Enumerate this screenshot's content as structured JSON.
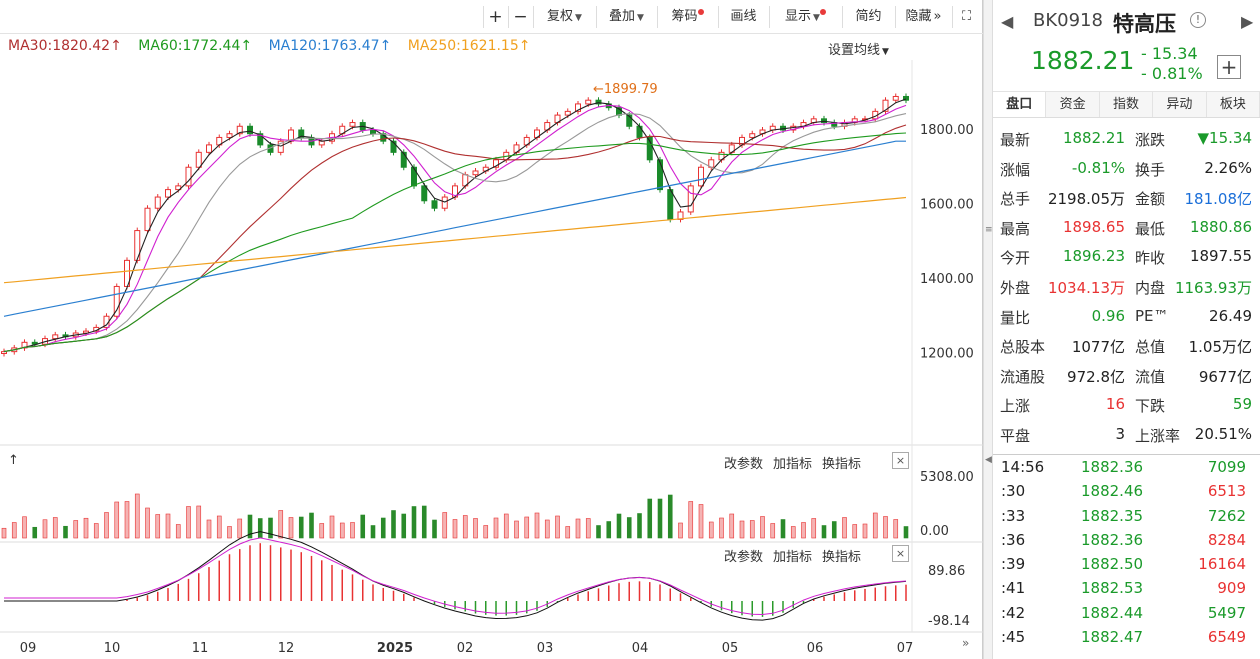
{
  "toolbar": {
    "plus": "+",
    "minus": "−",
    "fuquan": "复权",
    "diejia": "叠加",
    "chouma": "筹码",
    "huaxian": "画线",
    "xianshi": "显示",
    "jianyue": "简约",
    "yincang": "隐藏",
    "forward_icon": "»",
    "fullscreen_icon": "⛶"
  },
  "ma": {
    "ma30": "MA30:1820.42",
    "ma60": "MA60:1772.44",
    "ma120": "MA120:1763.47",
    "ma250": "MA250:1621.15",
    "arrow": "↑",
    "set_label": "设置均线",
    "colors": {
      "ma30": "#b03030",
      "ma60": "#1f9a1f",
      "ma120": "#2a7fd0",
      "ma250": "#f0a020"
    }
  },
  "chart_data": {
    "type": "candlestick",
    "price_axis": [
      "1800.00",
      "1600.00",
      "1400.00",
      "1200.00"
    ],
    "high_annotation": "1899.79",
    "volume_axis": [
      "5308.00",
      "0.00"
    ],
    "macd_axis": [
      "89.86",
      "-98.14"
    ],
    "x_labels": [
      "09",
      "10",
      "11",
      "12",
      "2025",
      "02",
      "03",
      "04",
      "05",
      "06",
      "07"
    ],
    "price_close": [
      1205,
      1215,
      1230,
      1225,
      1240,
      1250,
      1245,
      1255,
      1260,
      1270,
      1300,
      1380,
      1450,
      1530,
      1590,
      1620,
      1640,
      1650,
      1700,
      1740,
      1760,
      1780,
      1790,
      1810,
      1790,
      1760,
      1740,
      1770,
      1800,
      1780,
      1760,
      1770,
      1790,
      1810,
      1820,
      1800,
      1790,
      1770,
      1740,
      1700,
      1650,
      1610,
      1590,
      1620,
      1650,
      1680,
      1690,
      1700,
      1720,
      1740,
      1760,
      1780,
      1800,
      1820,
      1840,
      1850,
      1870,
      1880,
      1870,
      1860,
      1840,
      1810,
      1780,
      1720,
      1640,
      1560,
      1580,
      1650,
      1700,
      1720,
      1740,
      1760,
      1780,
      1790,
      1800,
      1810,
      1800,
      1810,
      1820,
      1830,
      1820,
      1810,
      1820,
      1830,
      1830,
      1850,
      1880,
      1890,
      1880
    ]
  },
  "panels": {
    "gaicanshu": "改参数",
    "jiazhibiao": "加指标",
    "huanzhibiao": "换指标",
    "close": "×"
  },
  "stock": {
    "code": "BK0918",
    "name": "特高压",
    "price": "1882.21",
    "change": "- 15.34",
    "change_pct": "- 0.81%",
    "add_icon": "+"
  },
  "tabs": [
    "盘口",
    "资金",
    "指数",
    "异动",
    "板块"
  ],
  "quote": [
    {
      "l1": "最新",
      "v1": "1882.21",
      "c1": "green",
      "l2": "涨跌",
      "v2": "▼15.34",
      "c2": "green"
    },
    {
      "l1": "涨幅",
      "v1": "-0.81%",
      "c1": "green",
      "l2": "换手",
      "v2": "2.26%",
      "c2": "dark"
    },
    {
      "l1": "总手",
      "v1": "2198.05万",
      "c1": "dark",
      "l2": "金额",
      "v2": "181.08亿",
      "c2": "blue"
    },
    {
      "l1": "最高",
      "v1": "1898.65",
      "c1": "red",
      "l2": "最低",
      "v2": "1880.86",
      "c2": "green"
    },
    {
      "l1": "今开",
      "v1": "1896.23",
      "c1": "green",
      "l2": "昨收",
      "v2": "1897.55",
      "c2": "dark"
    },
    {
      "l1": "外盘",
      "v1": "1034.13万",
      "c1": "red",
      "l2": "内盘",
      "v2": "1163.93万",
      "c2": "green"
    },
    {
      "l1": "量比",
      "v1": "0.96",
      "c1": "green",
      "l2": "PE™",
      "v2": "26.49",
      "c2": "dark"
    },
    {
      "l1": "总股本",
      "v1": "1077亿",
      "c1": "dark",
      "l2": "总值",
      "v2": "1.05万亿",
      "c2": "dark"
    },
    {
      "l1": "流通股",
      "v1": "972.8亿",
      "c1": "dark",
      "l2": "流值",
      "v2": "9677亿",
      "c2": "dark"
    },
    {
      "l1": "上涨",
      "v1": "16",
      "c1": "red",
      "l2": "下跌",
      "v2": "59",
      "c2": "green"
    },
    {
      "l1": "平盘",
      "v1": "3",
      "c1": "dark",
      "l2": "上涨率",
      "v2": "20.51%",
      "c2": "dark"
    }
  ],
  "ticks": [
    {
      "t": "14:56",
      "p": "1882.36",
      "v": "7099",
      "c": "green"
    },
    {
      "t": ":30",
      "p": "1882.46",
      "v": "6513",
      "c": "red"
    },
    {
      "t": ":33",
      "p": "1882.35",
      "v": "7262",
      "c": "green"
    },
    {
      "t": ":36",
      "p": "1882.36",
      "v": "8284",
      "c": "red"
    },
    {
      "t": ":39",
      "p": "1882.50",
      "v": "16164",
      "c": "red"
    },
    {
      "t": ":41",
      "p": "1882.53",
      "v": "909",
      "c": "red"
    },
    {
      "t": ":42",
      "p": "1882.44",
      "v": "5497",
      "c": "green"
    },
    {
      "t": ":45",
      "p": "1882.47",
      "v": "6549",
      "c": "red"
    }
  ]
}
